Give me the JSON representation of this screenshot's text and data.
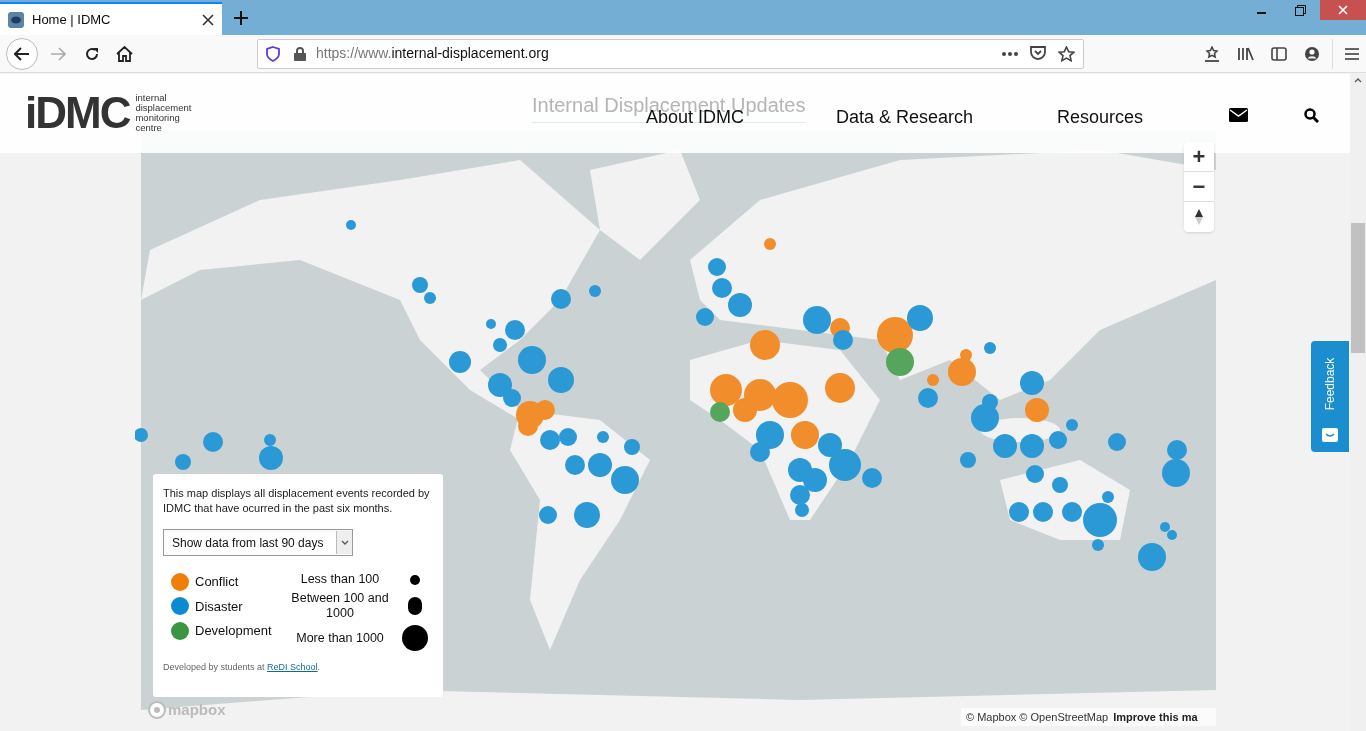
{
  "browser": {
    "tab": {
      "title": "Home | IDMC",
      "selected": true
    },
    "url": {
      "prefix": "https://www.",
      "domain": "internal-displacement.org"
    }
  },
  "header": {
    "logo": {
      "mark": "iDMC",
      "tagline": [
        "internal",
        "displacement",
        "monitoring",
        "centre"
      ]
    },
    "faded_title": "Internal Displacement Updates",
    "nav": [
      "About IDMC",
      "Data & Research",
      "Resources"
    ]
  },
  "map": {
    "zoom_in": "+",
    "zoom_out": "−",
    "attribution": "© Mapbox © OpenStreetMap",
    "improve": "Improve this ma",
    "logo": "mapbox"
  },
  "legend": {
    "description": "This map displays all displacement events recorded by IDMC that have ocurred in the past six months.",
    "period_select": {
      "value": "Show data from last 90 days"
    },
    "types": [
      {
        "label": "Conflict",
        "color": "#f07f09"
      },
      {
        "label": "Disaster",
        "color": "#0a8bd1"
      },
      {
        "label": "Development",
        "color": "#3a9642"
      }
    ],
    "sizes": [
      {
        "label": "Less than 100",
        "kind": "small"
      },
      {
        "label": "Between 100 and 1000",
        "kind": "medium"
      },
      {
        "label": "More than 1000",
        "kind": "large"
      }
    ],
    "credit": "Developed by students at",
    "credit_link": "ReDI School",
    "credit_end": "."
  },
  "feedback": "Feedback"
}
